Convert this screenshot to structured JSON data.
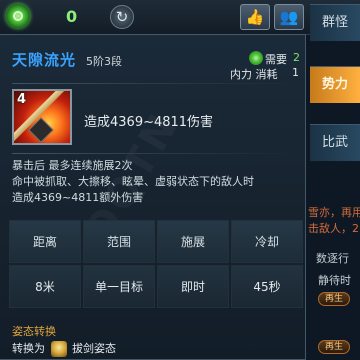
{
  "topbar": {
    "gem_count": "0",
    "refresh_glyph": "↻",
    "thumb_glyph": "👍",
    "people_glyph": "👥"
  },
  "side_tabs": [
    {
      "label": "群怪"
    },
    {
      "label": "势力",
      "active": true
    },
    {
      "label": "比武"
    }
  ],
  "background": {
    "text1": "雪亦，再用",
    "text2": "击敌人，2",
    "text3": "数逐行",
    "text4": "静待时",
    "btn_label": "再生"
  },
  "skill": {
    "name": "天隙流光",
    "stage": "5阶3段",
    "need_label": "需要",
    "need_value": "2",
    "cost_label": "内力 消耗",
    "cost_value": "1",
    "level": "4",
    "damage": "造成4369~4811伤害",
    "desc_lines": [
      "暴击后 最多连续施展2次",
      "命中被抓取、大擦移、眩晕、虚弱状态下的敌人时",
      "造成4369~4811额外伤害"
    ]
  },
  "stats": {
    "headers": [
      "距离",
      "范围",
      "施展",
      "冷却"
    ],
    "values": [
      "8米",
      "单一目标",
      "即时",
      "45秒"
    ]
  },
  "stance": {
    "title": "姿态转换",
    "prefix": "转换为",
    "suffix": "拔剑姿态"
  },
  "colors": {
    "skill_name": "#3aa3ff",
    "active_tab": "#ffb040",
    "stance_title": "#e0a53c"
  }
}
